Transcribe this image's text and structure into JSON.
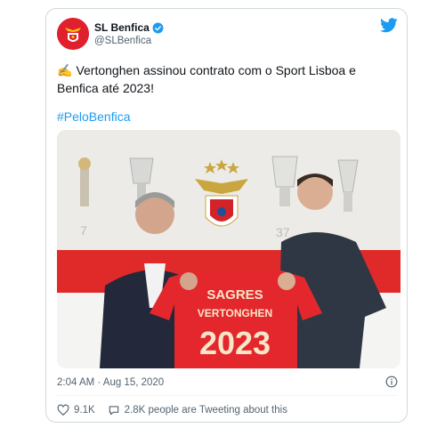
{
  "account": {
    "display_name": "SL Benfica",
    "handle": "@SLBenfica"
  },
  "tweet": {
    "emoji": "✍️",
    "text": "Vertonghen assinou contrato com o Sport Lisboa e Benfica até 2023!",
    "hashtag": "#PeloBenfica"
  },
  "photo": {
    "shirt_sponsor": "SAGRES",
    "shirt_name": "VERTONGHEN",
    "shirt_year": "2023",
    "wall_numbers": [
      "7",
      "37"
    ]
  },
  "meta": {
    "timestamp": "2:04 AM · Aug 15, 2020"
  },
  "actions": {
    "likes": "9.1K",
    "conversation": "2.8K people are Tweeting about this"
  },
  "colors": {
    "brand_red": "#e0202c",
    "link_blue": "#1d9bf0",
    "text_dark": "#0f1419",
    "text_grey": "#536471"
  }
}
